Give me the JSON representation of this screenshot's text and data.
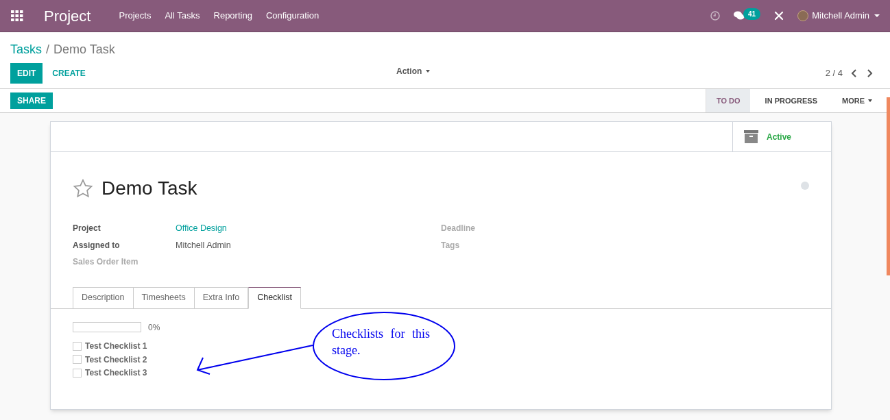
{
  "navbar": {
    "app_title": "Project",
    "menu": [
      "Projects",
      "All Tasks",
      "Reporting",
      "Configuration"
    ],
    "message_count": "41",
    "user": "Mitchell Admin"
  },
  "breadcrumb": {
    "parent": "Tasks",
    "separator": "/",
    "current": "Demo Task"
  },
  "buttons": {
    "edit": "EDIT",
    "create": "CREATE",
    "action": "Action",
    "share": "SHARE"
  },
  "pager": "2 / 4",
  "stages": [
    {
      "label": "TO DO",
      "selected": true
    },
    {
      "label": "IN PROGRESS",
      "selected": false
    },
    {
      "label": "MORE",
      "selected": false
    }
  ],
  "active_button": "Active",
  "task": {
    "title": "Demo Task",
    "starred": false
  },
  "fields_left": [
    {
      "label": "Project",
      "value": "Office Design",
      "kind": "link",
      "required": true
    },
    {
      "label": "Assigned to",
      "value": "Mitchell Admin",
      "kind": "text",
      "required": true
    },
    {
      "label": "Sales Order Item",
      "kind": "empty",
      "required": false
    }
  ],
  "fields_right": [
    {
      "label": "Deadline"
    },
    {
      "label": "Tags"
    }
  ],
  "tabs": [
    {
      "label": "Description",
      "selected": false
    },
    {
      "label": "Timesheets",
      "selected": false
    },
    {
      "label": "Extra Info",
      "selected": false
    },
    {
      "label": "Checklist",
      "selected": true
    }
  ],
  "checklist": {
    "level": 0,
    "percent": "0%",
    "items": [
      {
        "label": "Test Checklist 1",
        "checked": false
      },
      {
        "label": "Test Checklist 2",
        "checked": false
      },
      {
        "label": "Test Checklist 3",
        "checked": false
      }
    ]
  },
  "annotation": "Checklists for this stage."
}
